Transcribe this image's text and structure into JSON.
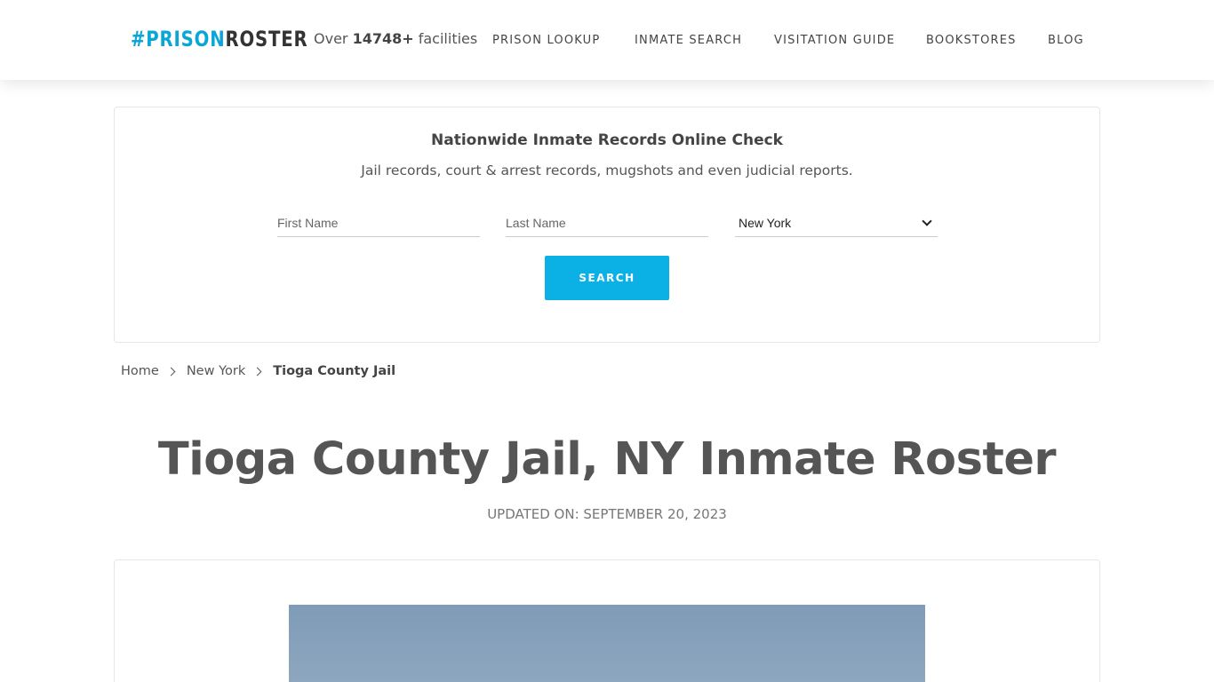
{
  "header": {
    "logo": {
      "hash": "#",
      "prison": "PRISON",
      "roster": "ROSTER"
    },
    "facilities": {
      "prefix": "Over ",
      "count": "14748+",
      "suffix": " facilities"
    },
    "nav": [
      {
        "label": "PRISON LOOKUP"
      },
      {
        "label": "INMATE SEARCH"
      },
      {
        "label": "VISITATION GUIDE"
      },
      {
        "label": "BOOKSTORES"
      },
      {
        "label": "BLOG"
      }
    ]
  },
  "search": {
    "title": "Nationwide Inmate Records Online Check",
    "subtitle": "Jail records, court & arrest records, mugshots and even judicial reports.",
    "first_name_placeholder": "First Name",
    "last_name_placeholder": "Last Name",
    "state_selected": "New York",
    "button_label": "SEARCH"
  },
  "breadcrumb": {
    "home": "Home",
    "state": "New York",
    "current": "Tioga County Jail"
  },
  "page": {
    "title": "Tioga County Jail, NY Inmate Roster",
    "updated": "UPDATED ON: SEPTEMBER 20, 2023"
  },
  "colors": {
    "accent": "#0bb1e4",
    "text": "#555555"
  }
}
